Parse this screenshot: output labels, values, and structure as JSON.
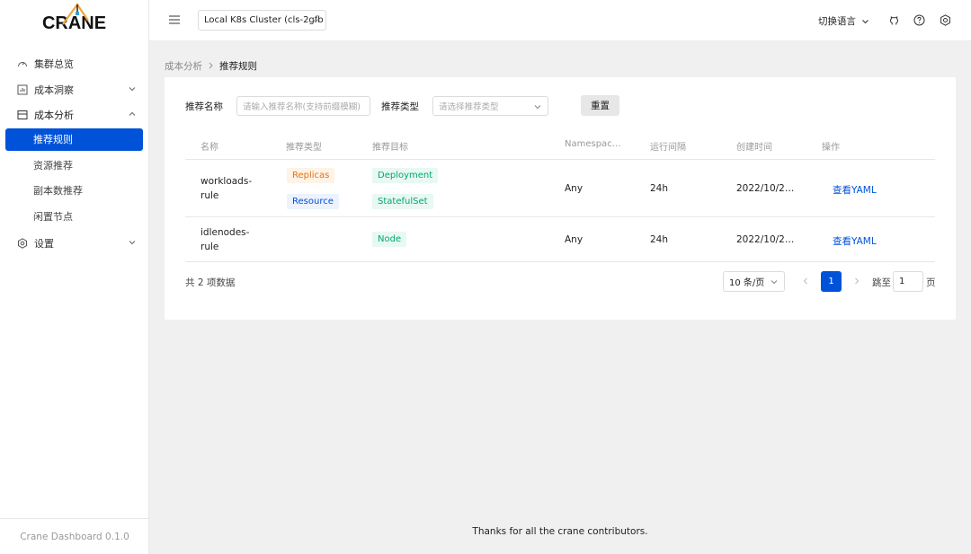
{
  "app": {
    "logo": "CRANE",
    "version": "Crane Dashboard 0.1.0"
  },
  "header": {
    "cluster": "Local K8s Cluster (cls-2gfb",
    "language": "切换语言",
    "icons": [
      "menu-icon",
      "github-icon",
      "help-icon",
      "settings-icon"
    ]
  },
  "sidebar": {
    "items": [
      {
        "label": "集群总览",
        "icon": "dashboard-icon"
      },
      {
        "label": "成本洞察",
        "icon": "chart-icon"
      },
      {
        "label": "成本分析",
        "icon": "analysis-icon",
        "children": [
          {
            "label": "推荐规则",
            "active": true
          },
          {
            "label": "资源推荐"
          },
          {
            "label": "副本数推荐"
          },
          {
            "label": "闲置节点"
          }
        ]
      },
      {
        "label": "设置",
        "icon": "settings-icon"
      }
    ]
  },
  "breadcrumb": {
    "parent": "成本分析",
    "current": "推荐规则"
  },
  "filters": {
    "name_label": "推荐名称",
    "name_placeholder": "请输入推荐名称(支持前缀模糊)",
    "type_label": "推荐类型",
    "type_placeholder": "请选择推荐类型",
    "reset": "重置"
  },
  "table": {
    "columns": [
      "名称",
      "推荐类型",
      "推荐目标",
      "Namespac…",
      "运行间隔",
      "创建时间",
      "操作"
    ],
    "rows": [
      {
        "name": "workloads-rule",
        "types": [
          "Replicas",
          "Resource"
        ],
        "targets": [
          "Deployment",
          "StatefulSet"
        ],
        "namespace": "Any",
        "interval": "24h",
        "created": "2022/10/2…",
        "action": "查看YAML"
      },
      {
        "name": "idlenodes-rule",
        "types": [],
        "targets": [
          "Node"
        ],
        "namespace": "Any",
        "interval": "24h",
        "created": "2022/10/2…",
        "action": "查看YAML"
      }
    ]
  },
  "pagination": {
    "total": "共 2 项数据",
    "page_size": "10 条/页",
    "current_page": "1",
    "jump_label": "跳至",
    "jump_value": "1",
    "page_suffix": "页"
  },
  "footer": "Thanks for all the crane contributors.",
  "colors": {
    "primary": "#0052d9",
    "orange": "#e37318",
    "green": "#00a870"
  }
}
